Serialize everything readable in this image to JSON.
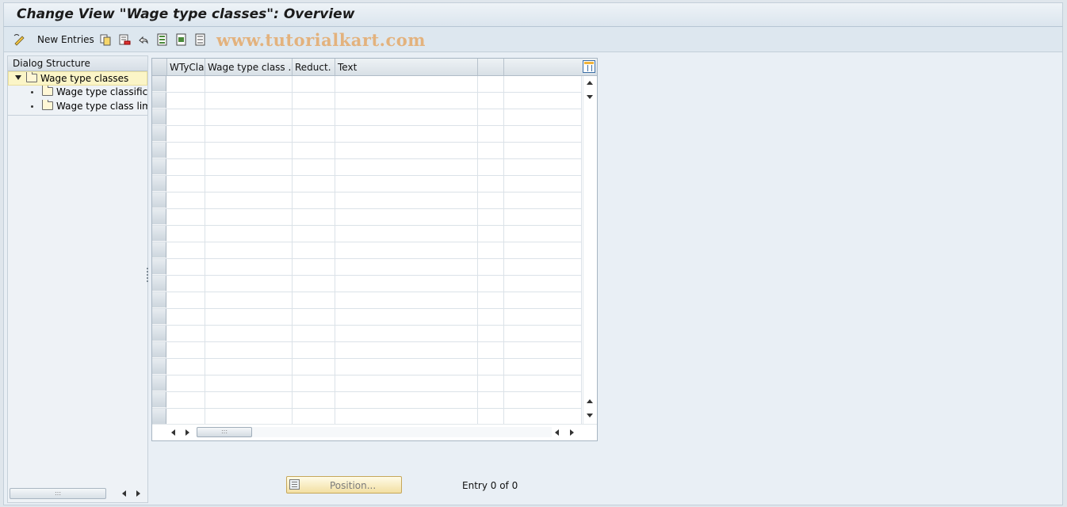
{
  "window": {
    "title": "Change View \"Wage type classes\": Overview"
  },
  "toolbar": {
    "new_entries_label": "New Entries",
    "watermark": "www.tutorialkart.com",
    "icons": [
      "display-change-icon",
      "copy-icon",
      "delete-icon",
      "undo-icon",
      "select-all-icon",
      "select-block-icon",
      "deselect-all-icon"
    ]
  },
  "dialog_structure": {
    "header": "Dialog Structure",
    "items": [
      {
        "label": "Wage type classes",
        "selected": true,
        "expanded": true
      },
      {
        "label": "Wage type classificat",
        "selected": false
      },
      {
        "label": "Wage type class limit",
        "selected": false
      }
    ]
  },
  "table": {
    "columns": [
      "WTyCla",
      "Wage type class ...",
      "Reduct.",
      "Text",
      "",
      ""
    ],
    "rows": []
  },
  "footer": {
    "position_label": "Position...",
    "entry_count": "Entry 0 of 0"
  },
  "colors": {
    "selected_row": "#fbf5c7",
    "watermark": "#e3b27d",
    "background": "#e9eff5"
  }
}
